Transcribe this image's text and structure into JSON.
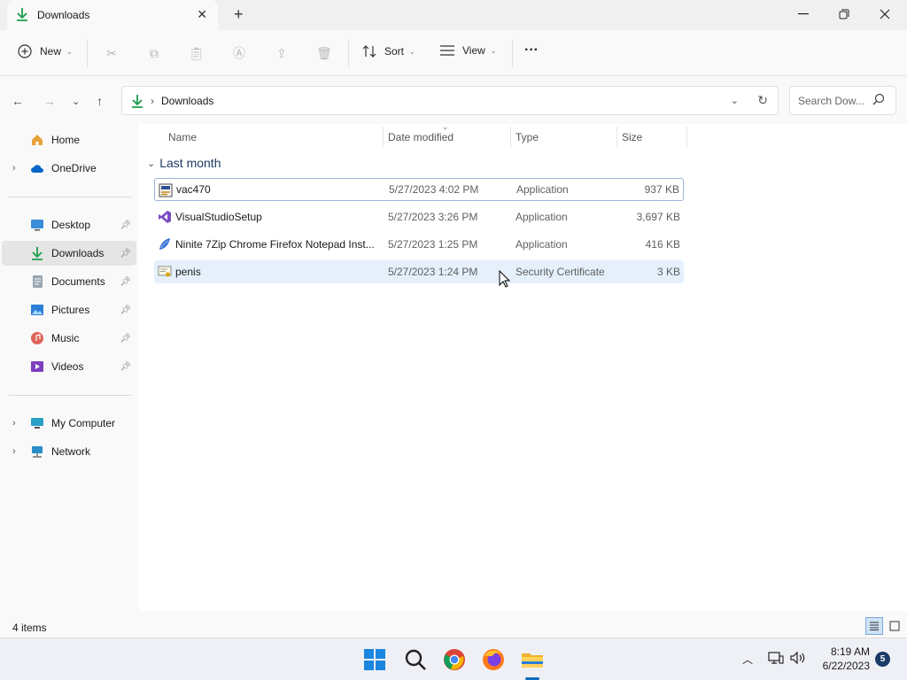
{
  "window": {
    "tab_title": "Downloads",
    "tab_icon": "download-icon",
    "colors": {
      "accent": "#0f7b0f",
      "selection": "#e5f0fb",
      "group_header": "#1b3a66",
      "download_green": "#1a9e4a"
    }
  },
  "toolbar": {
    "new_label": "New",
    "sort_label": "Sort",
    "view_label": "View",
    "more_label": "···"
  },
  "address": {
    "path": "Downloads",
    "search_placeholder": "Search Dow..."
  },
  "sidebar": {
    "quick": [
      {
        "label": "Home",
        "icon": "home-icon"
      },
      {
        "label": "OneDrive",
        "icon": "cloud-icon"
      }
    ],
    "pinned": [
      {
        "label": "Desktop",
        "icon": "desktop-icon"
      },
      {
        "label": "Downloads",
        "icon": "download-icon",
        "selected": true
      },
      {
        "label": "Documents",
        "icon": "document-icon"
      },
      {
        "label": "Pictures",
        "icon": "picture-icon"
      },
      {
        "label": "Music",
        "icon": "music-icon"
      },
      {
        "label": "Videos",
        "icon": "video-icon"
      }
    ],
    "devices": [
      {
        "label": "My Computer",
        "icon": "computer-icon"
      },
      {
        "label": "Network",
        "icon": "network-icon"
      }
    ]
  },
  "columns": {
    "name": "Name",
    "date": "Date modified",
    "type": "Type",
    "size": "Size"
  },
  "group": {
    "label": "Last month"
  },
  "files": [
    {
      "name": "vac470",
      "date": "5/27/2023 4:02 PM",
      "type": "Application",
      "size": "937 KB",
      "icon": "installer-icon"
    },
    {
      "name": "VisualStudioSetup",
      "date": "5/27/2023 3:26 PM",
      "type": "Application",
      "size": "3,697 KB",
      "icon": "visual-studio-icon"
    },
    {
      "name": "Ninite 7Zip Chrome Firefox Notepad Inst...",
      "date": "5/27/2023 1:25 PM",
      "type": "Application",
      "size": "416 KB",
      "icon": "ninite-icon"
    },
    {
      "name": "penis",
      "date": "5/27/2023 1:24 PM",
      "type": "Security Certificate",
      "size": "3 KB",
      "icon": "certificate-icon"
    }
  ],
  "status": {
    "count": "4 items"
  },
  "taskbar": {
    "time": "8:19 AM",
    "date": "6/22/2023",
    "notifications": "5",
    "apps": [
      "start-icon",
      "search-icon",
      "chrome-icon",
      "firefox-icon",
      "file-explorer-icon"
    ]
  }
}
